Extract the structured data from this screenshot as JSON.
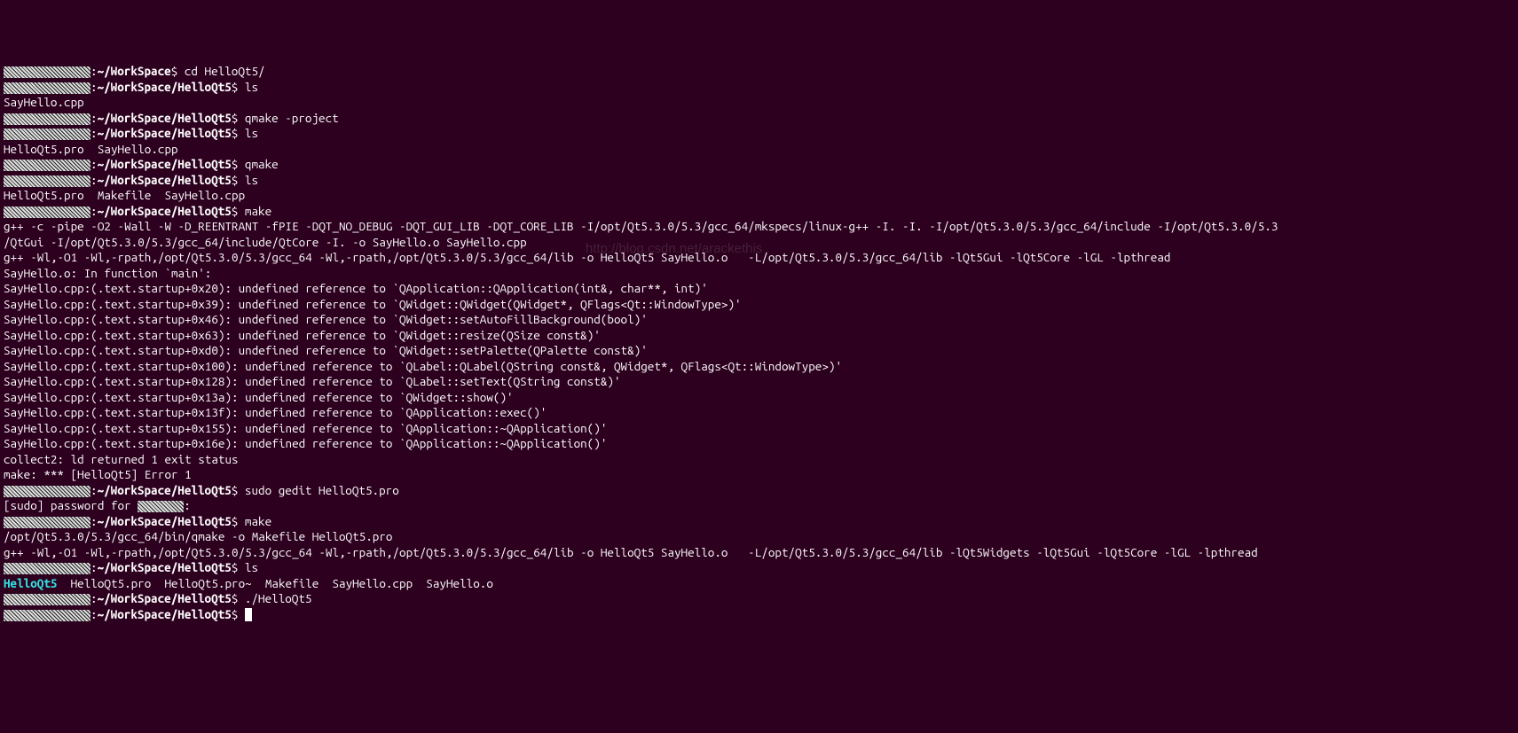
{
  "user_redacted": true,
  "host_redacted": true,
  "home_path": "~/WorkSpace",
  "proj_path": "~/WorkSpace/HelloQt5",
  "commands": {
    "cd": "cd HelloQt5/",
    "ls": "ls",
    "qmake_project": "qmake -project",
    "qmake": "qmake",
    "make": "make",
    "sudo_gedit": "sudo gedit HelloQt5.pro",
    "run": "./HelloQt5"
  },
  "outputs": {
    "ls1": "SayHello.cpp",
    "ls2": "HelloQt5.pro  SayHello.cpp",
    "ls3": "HelloQt5.pro  Makefile  SayHello.cpp",
    "make_cpp": "g++ -c -pipe -O2 -Wall -W -D_REENTRANT -fPIE -DQT_NO_DEBUG -DQT_GUI_LIB -DQT_CORE_LIB -I/opt/Qt5.3.0/5.3/gcc_64/mkspecs/linux-g++ -I. -I. -I/opt/Qt5.3.0/5.3/gcc_64/include -I/opt/Qt5.3.0/5.3",
    "make_cpp2": "/QtGui -I/opt/Qt5.3.0/5.3/gcc_64/include/QtCore -I. -o SayHello.o SayHello.cpp",
    "make_link": "g++ -Wl,-O1 -Wl,-rpath,/opt/Qt5.3.0/5.3/gcc_64 -Wl,-rpath,/opt/Qt5.3.0/5.3/gcc_64/lib -o HelloQt5 SayHello.o   -L/opt/Qt5.3.0/5.3/gcc_64/lib -lQt5Gui -lQt5Core -lGL -lpthread ",
    "err_main": "SayHello.o: In function `main':",
    "err_lines": [
      "SayHello.cpp:(.text.startup+0x20): undefined reference to `QApplication::QApplication(int&, char**, int)'",
      "SayHello.cpp:(.text.startup+0x39): undefined reference to `QWidget::QWidget(QWidget*, QFlags<Qt::WindowType>)'",
      "SayHello.cpp:(.text.startup+0x46): undefined reference to `QWidget::setAutoFillBackground(bool)'",
      "SayHello.cpp:(.text.startup+0x63): undefined reference to `QWidget::resize(QSize const&)'",
      "SayHello.cpp:(.text.startup+0xd0): undefined reference to `QWidget::setPalette(QPalette const&)'",
      "SayHello.cpp:(.text.startup+0x100): undefined reference to `QLabel::QLabel(QString const&, QWidget*, QFlags<Qt::WindowType>)'",
      "SayHello.cpp:(.text.startup+0x128): undefined reference to `QLabel::setText(QString const&)'",
      "SayHello.cpp:(.text.startup+0x13a): undefined reference to `QWidget::show()'",
      "SayHello.cpp:(.text.startup+0x13f): undefined reference to `QApplication::exec()'",
      "SayHello.cpp:(.text.startup+0x155): undefined reference to `QApplication::~QApplication()'",
      "SayHello.cpp:(.text.startup+0x16e): undefined reference to `QApplication::~QApplication()'"
    ],
    "collect2": "collect2: ld returned 1 exit status",
    "make_err": "make: *** [HelloQt5] Error 1",
    "sudo_pw": "[sudo] password for ",
    "qmake_out": "/opt/Qt5.3.0/5.3/gcc_64/bin/qmake -o Makefile HelloQt5.pro",
    "make_link2": "g++ -Wl,-O1 -Wl,-rpath,/opt/Qt5.3.0/5.3/gcc_64 -Wl,-rpath,/opt/Qt5.3.0/5.3/gcc_64/lib -o HelloQt5 SayHello.o   -L/opt/Qt5.3.0/5.3/gcc_64/lib -lQt5Widgets -lQt5Gui -lQt5Core -lGL -lpthread ",
    "ls4_exec": "HelloQt5",
    "ls4_rest": "  HelloQt5.pro  HelloQt5.pro~  Makefile  SayHello.cpp  SayHello.o"
  },
  "watermark": "http://blog.csdn.net/arackethis"
}
